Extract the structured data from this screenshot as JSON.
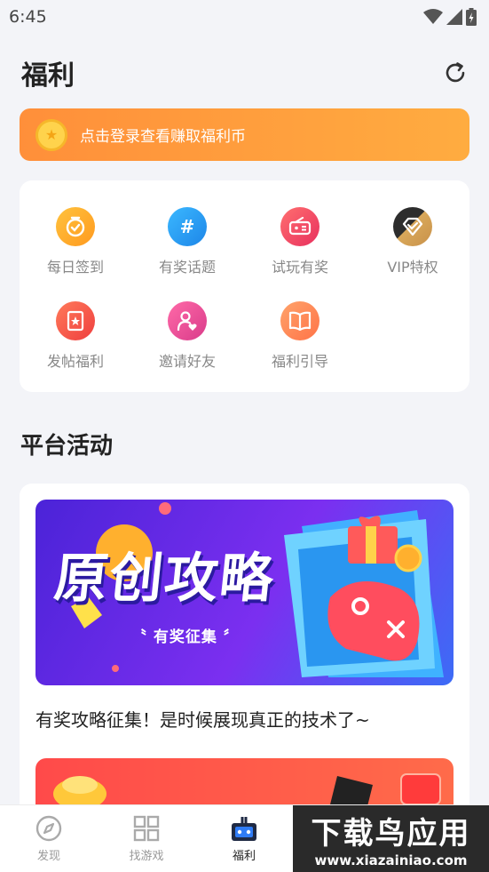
{
  "status_bar": {
    "time": "6:45"
  },
  "header": {
    "title": "福利"
  },
  "login_banner": {
    "text": "点击登录查看赚取福利币"
  },
  "grid": {
    "items": [
      {
        "label": "每日签到",
        "icon": "clock-check-icon",
        "color": "#ffa726"
      },
      {
        "label": "有奖话题",
        "icon": "hashtag-icon",
        "color": "#29a3f0"
      },
      {
        "label": "试玩有奖",
        "icon": "gamepad-icon",
        "color": "#f5446a"
      },
      {
        "label": "VIP特权",
        "icon": "diamond-icon",
        "color": "#3a3a3a"
      },
      {
        "label": "发帖福利",
        "icon": "star-note-icon",
        "color": "#f4574a"
      },
      {
        "label": "邀请好友",
        "icon": "user-heart-icon",
        "color": "#ec4f9a"
      },
      {
        "label": "福利引导",
        "icon": "book-icon",
        "color": "#ff8f5a"
      }
    ]
  },
  "section": {
    "title": "平台活动"
  },
  "activity": {
    "banner1_title": "原创攻略",
    "banner1_subtitle": "有奖征集",
    "caption": "有奖攻略征集！是时候展现真正的技术了~"
  },
  "bottom_nav": {
    "items": [
      {
        "label": "发现",
        "active": false
      },
      {
        "label": "找游戏",
        "active": false
      },
      {
        "label": "福利",
        "active": true
      }
    ]
  },
  "watermark": {
    "title": "下载鸟应用",
    "url": "www.xiazainiao.com"
  }
}
